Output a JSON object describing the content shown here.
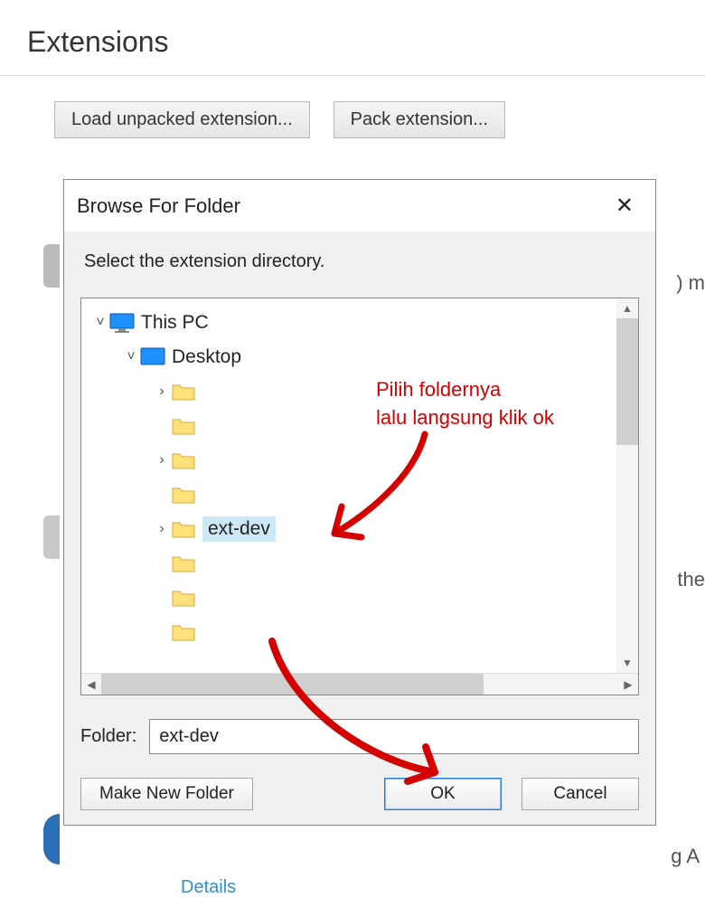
{
  "header": {
    "title": "Extensions"
  },
  "toolbar": {
    "load_unpacked_label": "Load unpacked extension...",
    "pack_extension_label": "Pack extension..."
  },
  "background_fragments": {
    "f1": ") m",
    "f2": "the",
    "f3": "g A"
  },
  "details_link": "Details",
  "dialog": {
    "title": "Browse For Folder",
    "instruction": "Select the extension directory.",
    "tree": {
      "root": {
        "label": "This PC"
      },
      "desktop": {
        "label": "Desktop"
      },
      "selected": {
        "label": "ext-dev"
      }
    },
    "folder_field": {
      "label": "Folder:",
      "value": "ext-dev"
    },
    "buttons": {
      "make_new": "Make New Folder",
      "ok": "OK",
      "cancel": "Cancel"
    }
  },
  "annotation": {
    "line1": "Pilih foldernya",
    "line2": "lalu langsung klik ok"
  }
}
